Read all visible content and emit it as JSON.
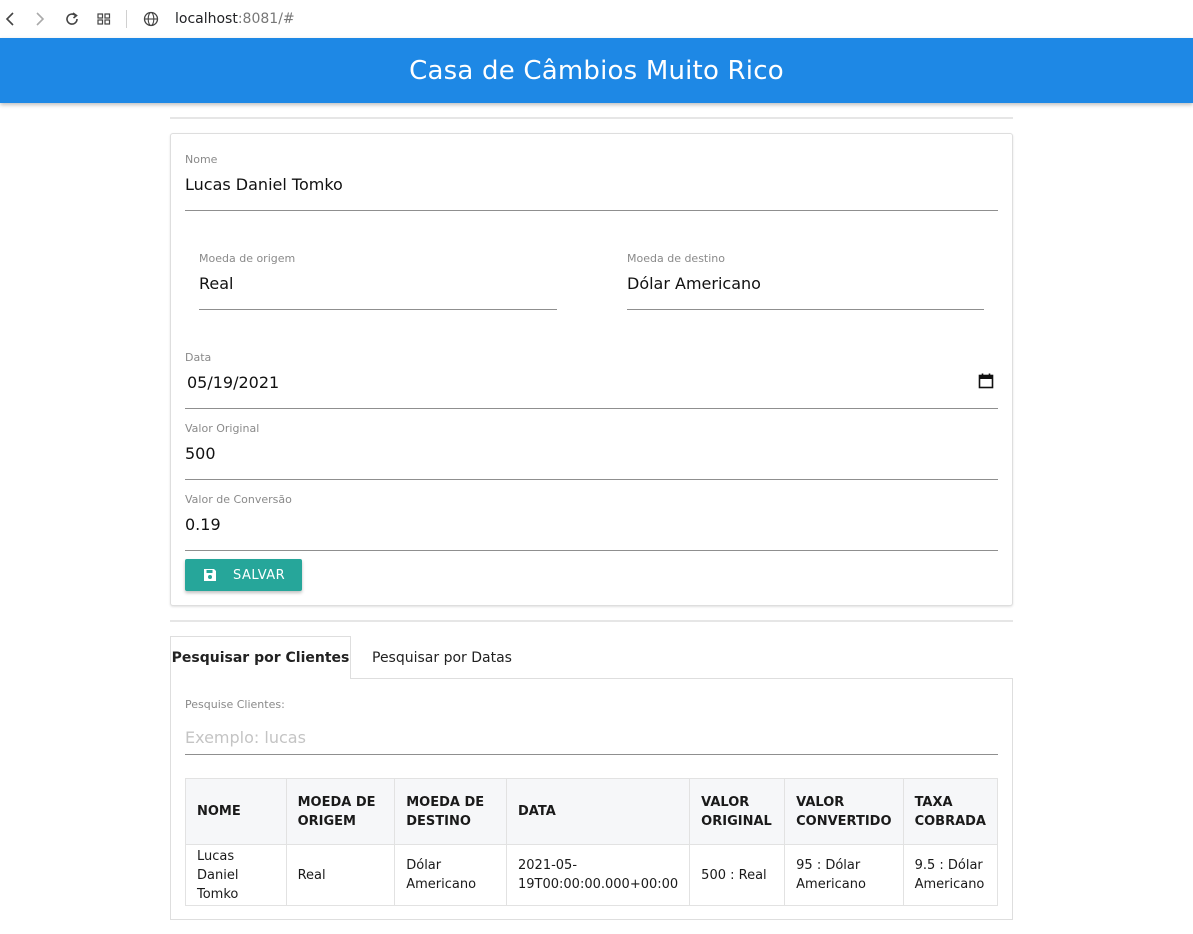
{
  "browser": {
    "url_host": "localhost",
    "url_rest": ":8081/#"
  },
  "header": {
    "title": "Casa de Câmbios Muito Rico"
  },
  "form": {
    "nome": {
      "label": "Nome",
      "value": "Lucas Daniel Tomko"
    },
    "moeda_origem": {
      "label": "Moeda de origem",
      "value": "Real"
    },
    "moeda_destino": {
      "label": "Moeda de destino",
      "value": "Dólar Americano"
    },
    "data": {
      "label": "Data",
      "value": "05/19/2021"
    },
    "valor_original": {
      "label": "Valor Original",
      "value": "500"
    },
    "valor_conversao": {
      "label": "Valor de Conversão",
      "value": "0.19"
    },
    "save_label": "SALVAR"
  },
  "tabs": [
    {
      "label": "Pesquisar por Clientes",
      "active": true
    },
    {
      "label": "Pesquisar por Datas",
      "active": false
    }
  ],
  "search": {
    "label": "Pesquise Clientes:",
    "placeholder": "Exemplo: lucas"
  },
  "table": {
    "headers": [
      [
        "NOME"
      ],
      [
        "MOEDA DE",
        "ORIGEM"
      ],
      [
        "MOEDA DE",
        "DESTINO"
      ],
      [
        "DATA"
      ],
      [
        "VALOR",
        "ORIGINAL"
      ],
      [
        "VALOR",
        "CONVERTIDO"
      ],
      [
        "TAXA",
        "COBRADA"
      ]
    ],
    "rows": [
      [
        [
          "Lucas Daniel",
          "Tomko"
        ],
        [
          "Real"
        ],
        [
          "Dólar",
          "Americano"
        ],
        [
          "2021-05-",
          "19T00:00:00.000+00:00"
        ],
        [
          "500 : Real"
        ],
        [
          "95 : Dólar",
          "Americano"
        ],
        [
          "9.5 : Dólar",
          "Americano"
        ]
      ]
    ]
  },
  "colors": {
    "header_bg": "#1e88e5",
    "save_button_bg": "#26a69a"
  }
}
